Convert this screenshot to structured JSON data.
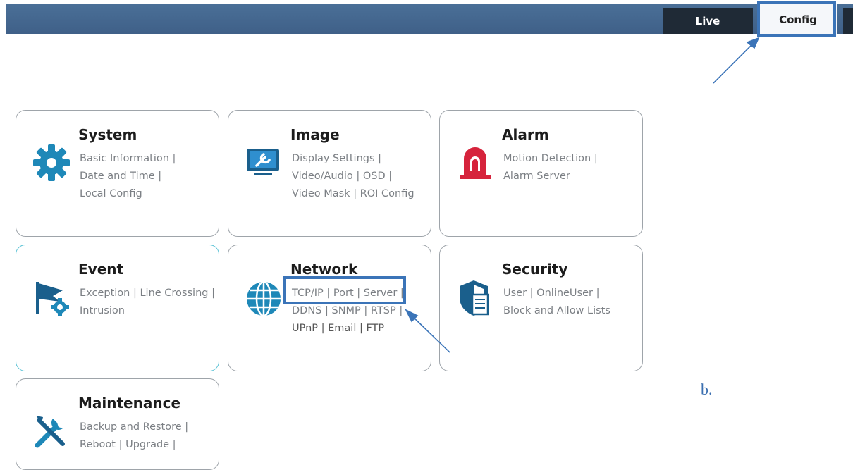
{
  "header": {
    "tabs": [
      {
        "label": "Live"
      },
      {
        "label": "Config"
      }
    ]
  },
  "cards": [
    {
      "title": "System",
      "icon": "gear-icon",
      "links": [
        "Basic Information |",
        "Date and Time |",
        "Local Config"
      ]
    },
    {
      "title": "Image",
      "icon": "monitor-wrench-icon",
      "links": [
        "Display Settings |",
        "Video/Audio | OSD |",
        "Video Mask | ROI Config"
      ]
    },
    {
      "title": "Alarm",
      "icon": "alarm-siren-icon",
      "links": [
        "Motion Detection |",
        "Alarm Server"
      ]
    },
    {
      "title": "Event",
      "icon": "flag-gear-icon",
      "links": [
        "Exception | Line Crossing |",
        "Intrusion"
      ]
    },
    {
      "title": "Network",
      "icon": "globe-icon",
      "links": [
        "TCP/IP | Port | Server |",
        "DDNS | SNMP | RTSP |",
        "UPnP | Email | FTP"
      ]
    },
    {
      "title": "Security",
      "icon": "shield-document-icon",
      "links": [
        "User | OnlineUser |",
        "Block and Allow Lists"
      ]
    },
    {
      "title": "Maintenance",
      "icon": "tools-icon",
      "links": [
        "Backup and Restore |",
        "Reboot | Upgrade |"
      ]
    }
  ],
  "annotation": {
    "label": "b."
  },
  "colors": {
    "topbar": "#3f6088",
    "highlight": "#3b74b8",
    "active_card_border": "#5cc3d6",
    "icon_blue": "#1e88b8",
    "icon_red": "#d6233c"
  }
}
